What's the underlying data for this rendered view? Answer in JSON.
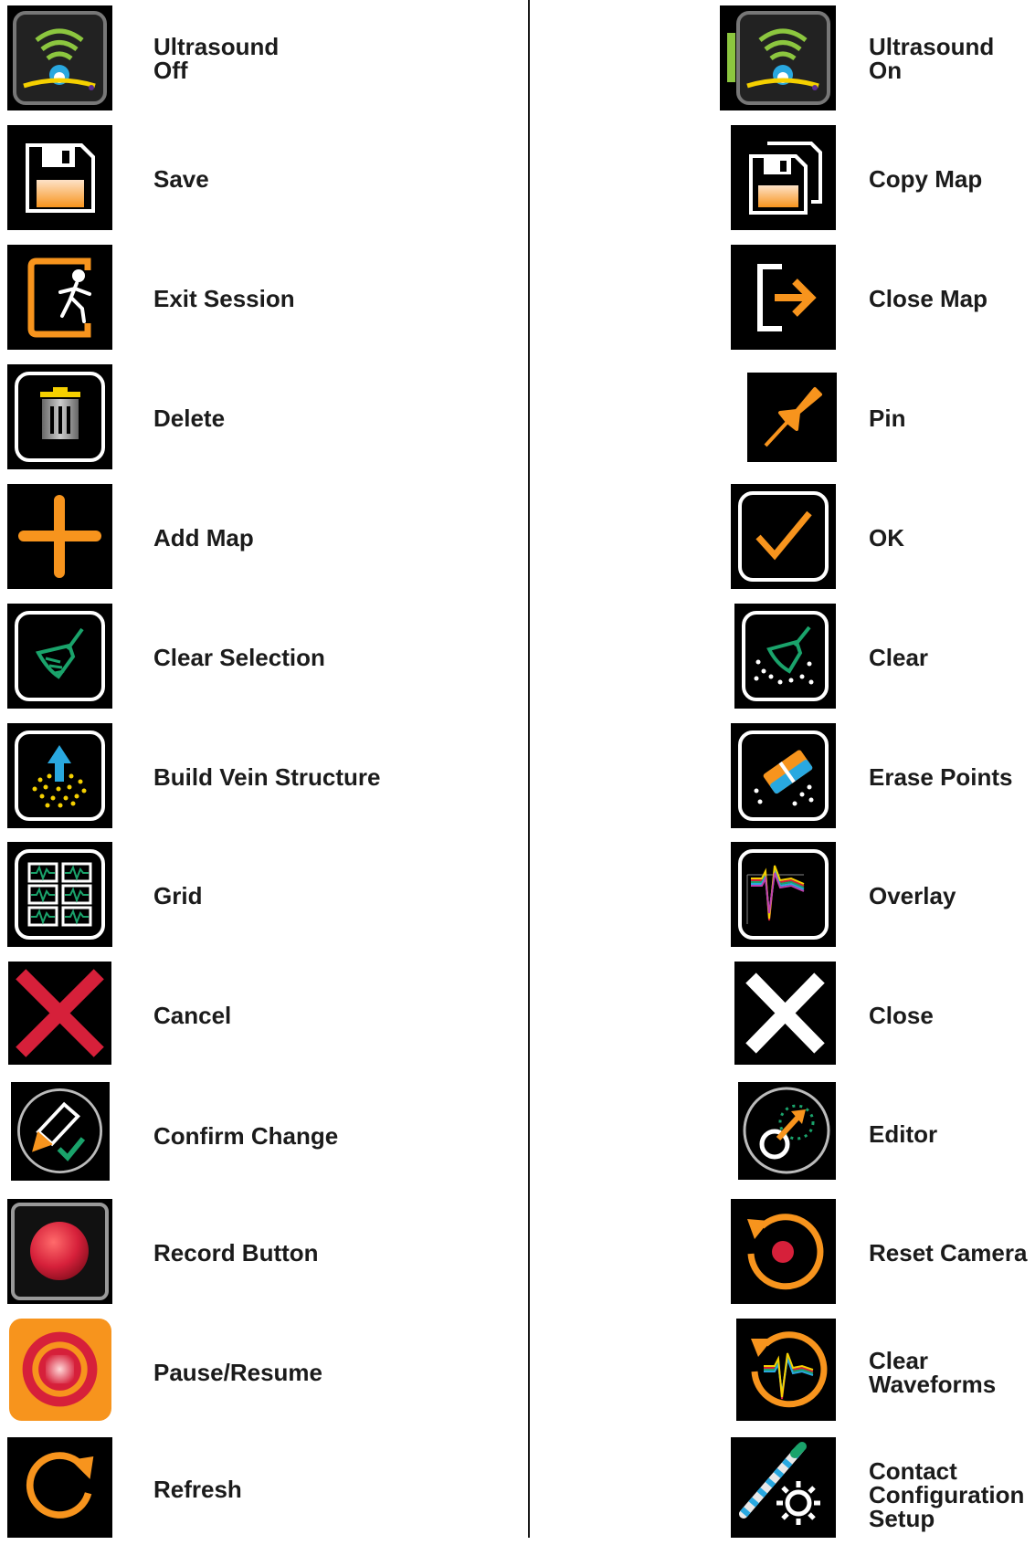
{
  "left": [
    {
      "id": "ultrasound-off",
      "label": "Ultrasound\nOff"
    },
    {
      "id": "save",
      "label": "Save"
    },
    {
      "id": "exit-session",
      "label": "Exit Session"
    },
    {
      "id": "delete",
      "label": "Delete"
    },
    {
      "id": "add-map",
      "label": "Add Map"
    },
    {
      "id": "clear-selection",
      "label": "Clear Selection"
    },
    {
      "id": "build-vein-structure",
      "label": "Build Vein Structure"
    },
    {
      "id": "grid",
      "label": "Grid"
    },
    {
      "id": "cancel",
      "label": "Cancel"
    },
    {
      "id": "confirm-change",
      "label": "Confirm Change"
    },
    {
      "id": "record-button",
      "label": "Record Button"
    },
    {
      "id": "pause-resume",
      "label": "Pause/Resume"
    },
    {
      "id": "refresh",
      "label": "Refresh"
    }
  ],
  "right": [
    {
      "id": "ultrasound-on",
      "label": "Ultrasound\nOn"
    },
    {
      "id": "copy-map",
      "label": "Copy Map"
    },
    {
      "id": "close-map",
      "label": "Close Map"
    },
    {
      "id": "pin",
      "label": "Pin"
    },
    {
      "id": "ok",
      "label": "OK"
    },
    {
      "id": "clear",
      "label": "Clear"
    },
    {
      "id": "erase-points",
      "label": "Erase Points"
    },
    {
      "id": "overlay",
      "label": "Overlay"
    },
    {
      "id": "close",
      "label": "Close"
    },
    {
      "id": "editor",
      "label": "Editor"
    },
    {
      "id": "reset-camera",
      "label": "Reset Camera"
    },
    {
      "id": "clear-waveforms",
      "label": "Clear\nWaveforms"
    },
    {
      "id": "contact-configuration-setup",
      "label": "Contact\nConfiguration\nSetup"
    }
  ],
  "colors": {
    "orange": "#f7941d",
    "green": "#1aa36b",
    "red": "#d6203a",
    "yellow": "#f5d000",
    "blue": "#29a8e0",
    "white": "#ffffff"
  }
}
